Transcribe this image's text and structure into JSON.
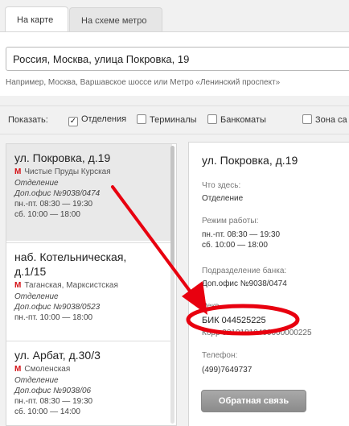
{
  "tabs": [
    {
      "label": "На карте",
      "active": true
    },
    {
      "label": "На схеме метро",
      "active": false
    }
  ],
  "search": {
    "value": "Россия, Москва, улица Покровка, 19",
    "hint": "Например, Москва, Варшавское шоссе или Метро «Ленинский проспект»"
  },
  "filters": {
    "show_label": "Показать:",
    "items": [
      {
        "label": "Отделения",
        "checked": true
      },
      {
        "label": "Терминалы",
        "checked": false
      },
      {
        "label": "Банкоматы",
        "checked": false
      },
      {
        "label": "Зона са",
        "checked": false
      }
    ]
  },
  "branches": [
    {
      "address": "ул. Покровка, д.19",
      "metro": "Чистые Пруды Курская",
      "kind": "Отделение",
      "office": "Доп.офис №9038/0474",
      "hours": [
        "пн.-пт. 08:30 — 19:30",
        "сб. 10:00 — 18:00"
      ],
      "selected": true
    },
    {
      "address_line1": "наб. Котельническая,",
      "address_line2": "д.1/15",
      "metro": "Таганская, Марксистская",
      "kind": "Отделение",
      "office": "Доп.офис №9038/0523",
      "hours": [
        "пн.-пт. 10:00 — 18:00"
      ],
      "selected": false
    },
    {
      "address": "ул. Арбат, д.30/3",
      "metro": "Смоленская",
      "kind": "Отделение",
      "office": "Доп.офис №9038/06",
      "hours": [
        "пн.-пт. 08:30 — 19:30",
        "сб. 10:00 — 14:00"
      ],
      "selected": false
    }
  ],
  "metro_icon": "М",
  "detail": {
    "title": "ул. Покровка, д.19",
    "what_label": "Что здесь:",
    "what_value": "Отделение",
    "mode_label": "Режим работы:",
    "mode_values": [
      "пн.-пт. 08:30 — 19:30",
      "сб. 10:00 — 18:00"
    ],
    "division_label": "Подразделение банка:",
    "division_value": "Доп.офис №9038/0474",
    "req_label": "Рекв",
    "bik": "БИК 044525225",
    "korr": "Корр 30101810400000000225",
    "phone_label": "Телефон:",
    "phone_value": "(499)7649737",
    "feedback_button": "Обратная связь"
  },
  "colors": {
    "accent_red": "#e8000f",
    "metro_red": "#d40f14"
  }
}
